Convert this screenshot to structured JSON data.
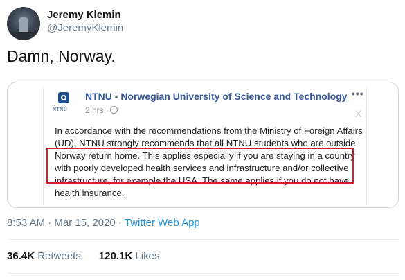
{
  "author": {
    "name": "Jeremy Klemin",
    "handle": "@JeremyKlemin"
  },
  "tweet": {
    "text": "Damn, Norway."
  },
  "embedded_post": {
    "page_name": "NTNU - Norwegian University of Science and Technology",
    "logo_text": "NTNU",
    "time": "2 hrs ·",
    "more": "•••",
    "close": "X",
    "lines": [
      "In accordance with the recommendations from the Ministry of Foreign Affairs",
      "(UD), NTNU strongly recommends that all NTNU students who are outside",
      "Norway return home. This applies especially if you are staying in a country",
      "with poorly developed health services and infrastructure and/or collective",
      "infrastructure, for example the USA. The same applies if you do not have",
      "health insurance."
    ]
  },
  "meta": {
    "timestamp": "8:53 AM · Mar 15, 2020 · ",
    "source": "Twitter Web App"
  },
  "stats": {
    "retweets_count": "36.4K",
    "retweets_label": "Retweets",
    "likes_count": "120.1K",
    "likes_label": "Likes"
  },
  "colors": {
    "link": "#1b95e0",
    "facebook_page": "#365899",
    "highlight": "#d0202a"
  }
}
